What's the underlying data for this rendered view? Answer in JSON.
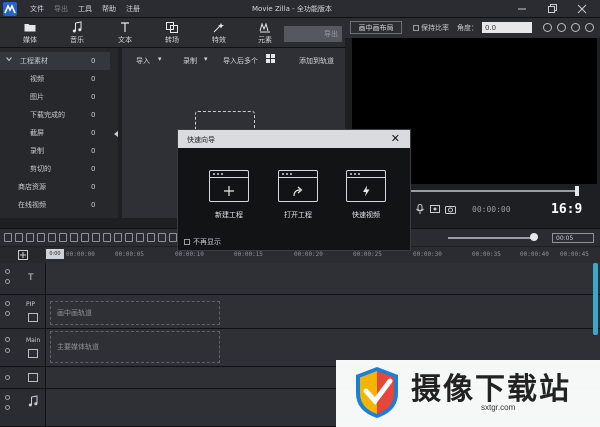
{
  "titlebar": {
    "menu": [
      "文件",
      "导出",
      "工具",
      "帮助",
      "注册"
    ],
    "app_title": "Movie Zilla  - 全功能版本",
    "window_controls": [
      "minimize-icon",
      "maximize-icon",
      "close-icon"
    ]
  },
  "toolbar": {
    "items": [
      {
        "label": "媒体",
        "icon": "folder-icon"
      },
      {
        "label": "音乐",
        "icon": "music-note-icon"
      },
      {
        "label": "文本",
        "icon": "text-t-icon"
      },
      {
        "label": "转场",
        "icon": "transition-icon"
      },
      {
        "label": "特效",
        "icon": "effects-icon"
      },
      {
        "label": "元素",
        "icon": "elements-icon"
      }
    ],
    "export_label": "导出"
  },
  "tree": {
    "items": [
      {
        "label": "工程素材",
        "count": "0",
        "selected": true
      },
      {
        "label": "视频",
        "count": "0"
      },
      {
        "label": "图片",
        "count": "0"
      },
      {
        "label": "下载完成的",
        "count": "0"
      },
      {
        "label": "截屏",
        "count": "0"
      },
      {
        "label": "录制",
        "count": "0"
      },
      {
        "label": "剪切的",
        "count": "0"
      },
      {
        "label": "商店资源",
        "count": "0"
      },
      {
        "label": "在线视频",
        "count": "0"
      }
    ]
  },
  "media": {
    "import_label": "导入",
    "record_label": "录制",
    "import_after_label": "导入后多个",
    "add_to_track_label": "添加到轨道"
  },
  "preview": {
    "pip_button": "画中画布局",
    "keep_ratio_label": "保持比率",
    "angle_label": "角度：",
    "angle_value": "0.0",
    "timecode": "00:00:00",
    "aspect_ratio": "16:9",
    "playhead_fraction": 1.0
  },
  "timeline": {
    "zoom_value": "00:05",
    "zoom_fraction": 0.95,
    "current_time": "0:00",
    "ticks": [
      "00:00:00",
      "00:00:05",
      "00:00:10",
      "00:00:15",
      "00:00:20",
      "00:00:25",
      "00:00:30",
      "00:00:35",
      "00:00:40",
      "00:00:45"
    ],
    "tracks": [
      {
        "label": "",
        "hint": ""
      },
      {
        "label": "PIP",
        "hint": "画中画轨道"
      },
      {
        "label": "Main",
        "hint": "主要媒体轨道"
      },
      {
        "label": "",
        "hint": ""
      },
      {
        "label": "",
        "hint": ""
      }
    ]
  },
  "wizard": {
    "title": "快速向导",
    "options": [
      {
        "label": "新建工程",
        "icon": "plus-icon"
      },
      {
        "label": "打开工程",
        "icon": "open-arrow-icon"
      },
      {
        "label": "快速视频",
        "icon": "lightning-icon"
      }
    ],
    "dont_show_label": "不再显示"
  },
  "watermark": {
    "text": "摄像下载站",
    "url": "sxtgr.com"
  }
}
